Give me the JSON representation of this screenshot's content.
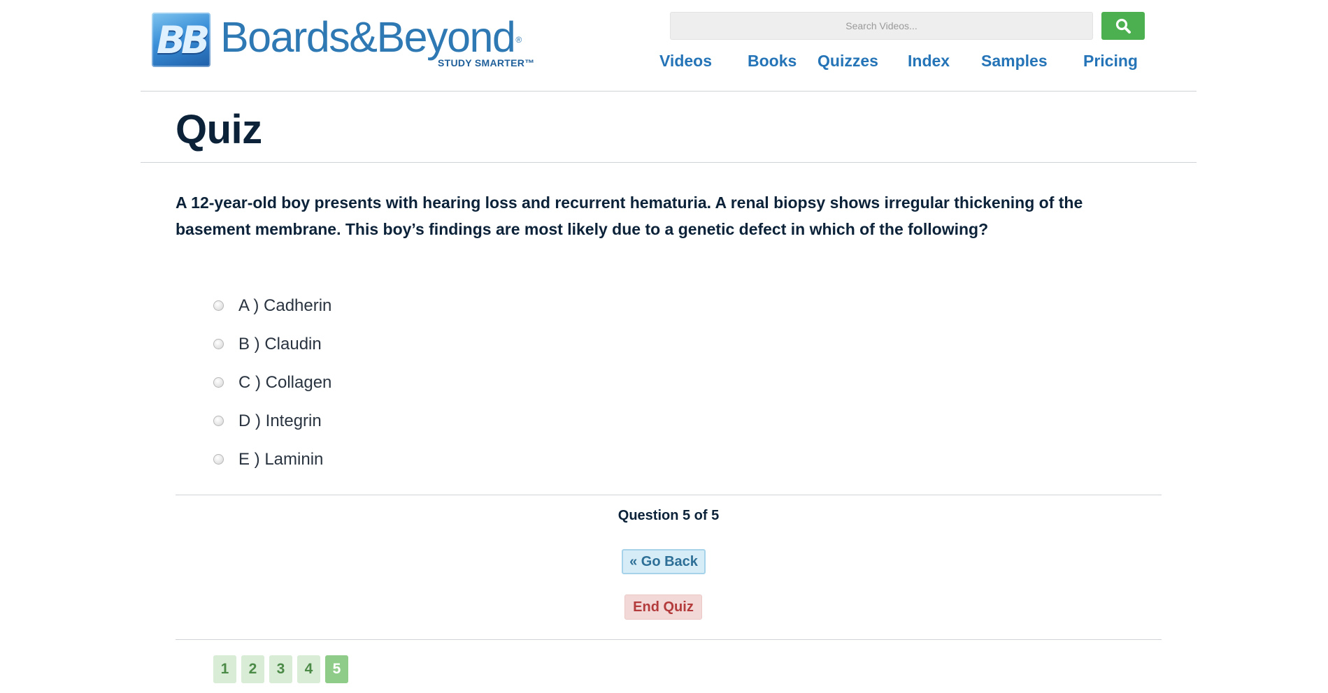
{
  "header": {
    "logo": {
      "mark": "BB",
      "word": "Boards&Beyond",
      "registered": "®",
      "tagline": "STUDY SMARTER™"
    },
    "search": {
      "placeholder": "Search Videos..."
    },
    "nav": [
      {
        "label": "Videos"
      },
      {
        "label": "Books"
      },
      {
        "label": "Quizzes"
      },
      {
        "label": "Index"
      },
      {
        "label": "Samples"
      },
      {
        "label": "Pricing"
      }
    ]
  },
  "page": {
    "title": "Quiz"
  },
  "quiz": {
    "question": "A 12-year-old boy presents with hearing loss and recurrent hematuria. A renal biopsy shows irregular thickening of the basement membrane. This boy’s findings are most likely due to a genetic defect in which of the following?",
    "options": [
      {
        "label": "A ) Cadherin"
      },
      {
        "label": "B ) Claudin"
      },
      {
        "label": "C ) Collagen"
      },
      {
        "label": "D ) Integrin"
      },
      {
        "label": "E ) Laminin"
      }
    ],
    "progress": "Question 5 of 5",
    "go_back_label": "« Go Back",
    "end_quiz_label": "End Quiz",
    "pages": [
      "1",
      "2",
      "3",
      "4",
      "5"
    ],
    "current_page": "5"
  },
  "colors": {
    "brand_blue": "#2474b7",
    "search_green": "#4cb050",
    "end_red": "#b33b3b",
    "page_green": "#8fcc8a",
    "title_navy": "#0b2239"
  },
  "icons": {
    "search": "magnifier-icon"
  }
}
